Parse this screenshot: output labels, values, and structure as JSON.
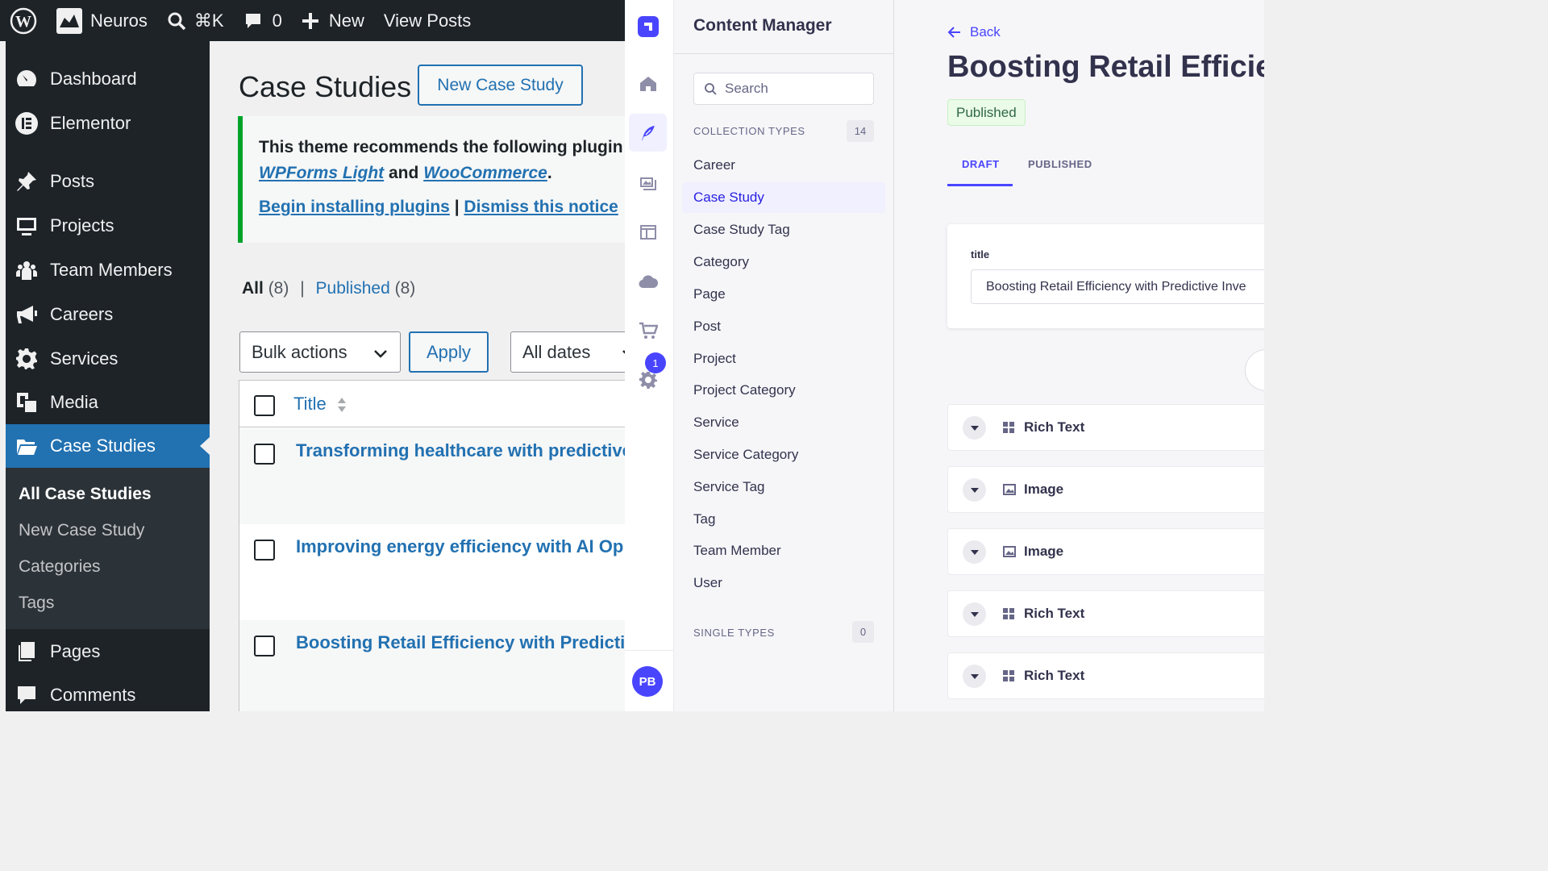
{
  "adminbar": {
    "site_name": "Neuros",
    "shortcut": "⌘K",
    "comments_count": "0",
    "new_label": "New",
    "view_posts": "View Posts"
  },
  "wp_menu": {
    "items": [
      {
        "label": "Dashboard",
        "icon": "dashboard-icon"
      },
      {
        "label": "Elementor",
        "icon": "elementor-icon"
      },
      {
        "label": "Posts",
        "icon": "pin-icon"
      },
      {
        "label": "Projects",
        "icon": "monitor-icon"
      },
      {
        "label": "Team Members",
        "icon": "users-icon"
      },
      {
        "label": "Careers",
        "icon": "megaphone-icon"
      },
      {
        "label": "Services",
        "icon": "gear-icon"
      },
      {
        "label": "Media",
        "icon": "media-icon"
      },
      {
        "label": "Case Studies",
        "icon": "folder-icon"
      },
      {
        "label": "Pages",
        "icon": "pages-icon"
      },
      {
        "label": "Comments",
        "icon": "comment-icon"
      }
    ],
    "submenu": [
      "All Case Studies",
      "New Case Study",
      "Categories",
      "Tags"
    ]
  },
  "wp_content": {
    "page_title": "Case Studies",
    "add_new": "New Case Study",
    "notice": {
      "line1": "This theme recommends the following plugin",
      "plugin1": "WPForms Light",
      "and": "and",
      "plugin2": "WooCommerce",
      "period": ".",
      "begin": "Begin installing plugins",
      "pipe": "|",
      "dismiss": "Dismiss this notice"
    },
    "filters": {
      "all": "All",
      "all_count": "(8)",
      "sep": "|",
      "published": "Published",
      "published_count": "(8)"
    },
    "bulk_actions": "Bulk actions",
    "apply": "Apply",
    "all_dates": "All dates",
    "column_title": "Title",
    "rows": [
      "Transforming healthcare with predictive",
      "Improving energy efficiency with AI Op",
      "Boosting Retail Efficiency with Predictive"
    ]
  },
  "strapi_rail": {
    "badge": "1",
    "avatar_initials": "PB"
  },
  "content_manager": {
    "title": "Content Manager",
    "search_placeholder": "Search",
    "collection_types_label": "COLLECTION TYPES",
    "collection_count": "14",
    "collection_types": [
      "Career",
      "Case Study",
      "Case Study Tag",
      "Category",
      "Page",
      "Post",
      "Project",
      "Project Category",
      "Service",
      "Service Category",
      "Service Tag",
      "Tag",
      "Team Member",
      "User"
    ],
    "active_type": "Case Study",
    "single_types_label": "SINGLE TYPES",
    "single_count": "0"
  },
  "edit_view": {
    "back": "Back",
    "title": "Boosting Retail Efficien",
    "status": "Published",
    "tabs": [
      "DRAFT",
      "PUBLISHED"
    ],
    "field_label": "title",
    "field_value": "Boosting Retail Efficiency with Predictive Inve",
    "blocks": [
      {
        "label": "Rich Text",
        "icon": "grid-icon"
      },
      {
        "label": "Image",
        "icon": "image-icon"
      },
      {
        "label": "Image",
        "icon": "image-icon"
      },
      {
        "label": "Rich Text",
        "icon": "grid-icon"
      },
      {
        "label": "Rich Text",
        "icon": "grid-icon"
      }
    ]
  },
  "colors": {
    "wp_dark": "#1d2327",
    "wp_blue": "#2271b1",
    "strapi_primary": "#4945ff",
    "notice_green": "#00a32a"
  }
}
